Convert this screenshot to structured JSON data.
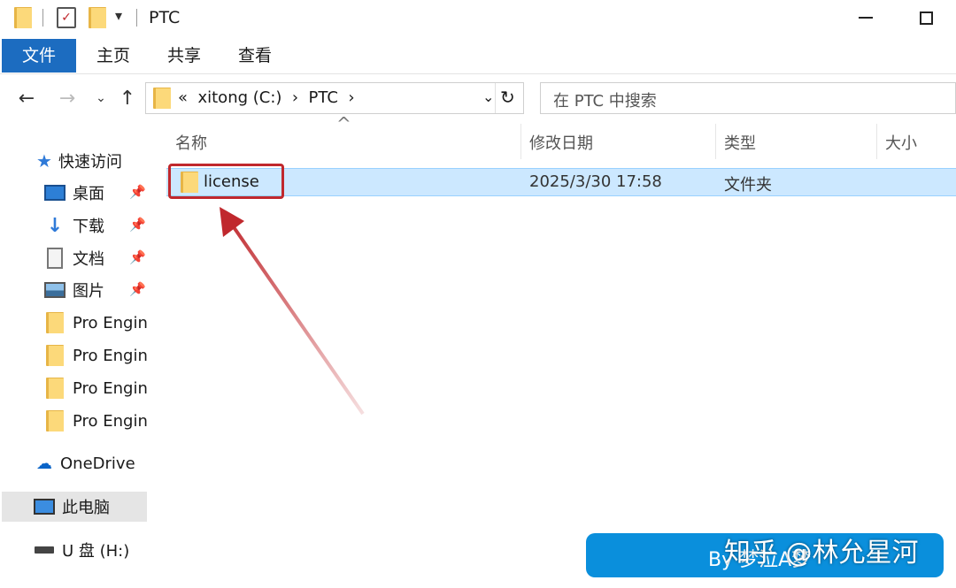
{
  "window": {
    "title": "PTC"
  },
  "ribbon": {
    "tabs": [
      "文件",
      "主页",
      "共享",
      "查看"
    ]
  },
  "address": {
    "prefix": "«",
    "segments": [
      "xitong (C:)",
      "PTC"
    ],
    "separator": "›",
    "search_placeholder": "在 PTC 中搜索"
  },
  "columns": {
    "name": "名称",
    "date": "修改日期",
    "type": "类型",
    "size": "大小"
  },
  "files": [
    {
      "name": "license",
      "date": "2025/3/30 17:58",
      "type": "文件夹"
    }
  ],
  "nav": {
    "quick_access": "快速访问",
    "pinned": [
      "桌面",
      "下载",
      "文档",
      "图片"
    ],
    "folders": [
      "Pro Engin",
      "Pro Engin",
      "Pro Engin",
      "Pro Engin"
    ],
    "onedrive": "OneDrive",
    "this_pc": "此电脑",
    "usb": "U 盘 (H:)"
  },
  "watermark": {
    "by": "By 梦泣A梦",
    "zh": "知乎 @林允星河"
  },
  "colors": {
    "accent": "#1c6cc0",
    "selection": "#cce8ff",
    "highlight": "#c0282d",
    "banner": "#0a8fdc"
  }
}
